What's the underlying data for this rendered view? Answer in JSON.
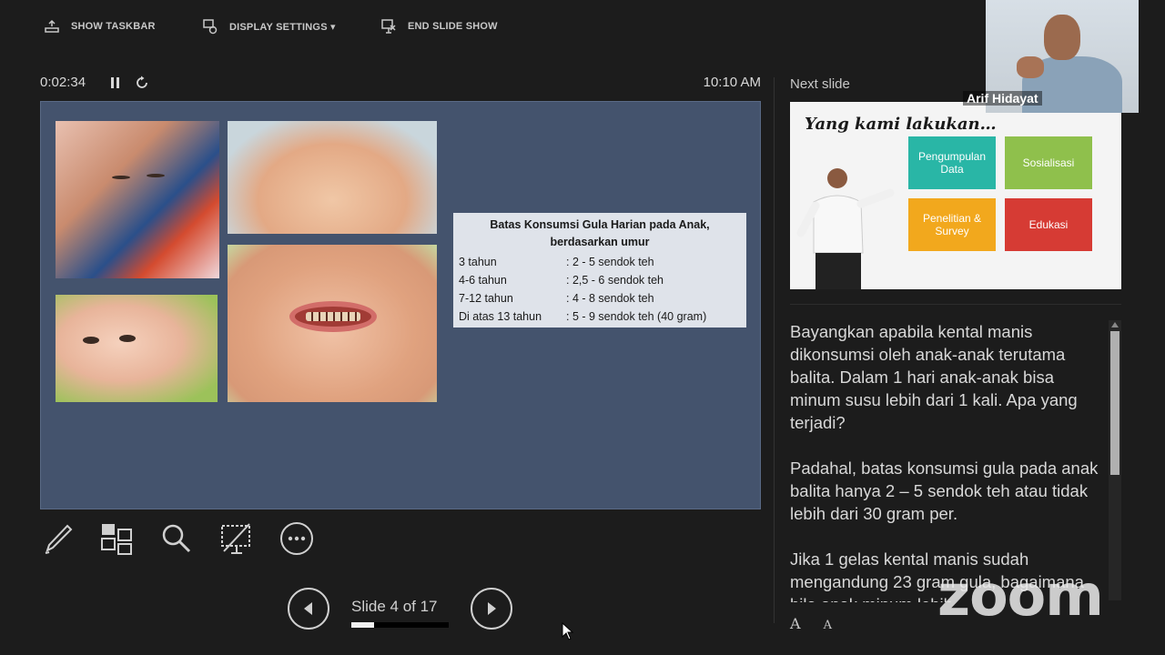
{
  "toolbar": {
    "show_taskbar": "SHOW TASKBAR",
    "display_settings": "DISPLAY SETTINGS ▾",
    "end_slide_show": "END SLIDE SHOW"
  },
  "presenter": {
    "timer": "0:02:34",
    "clock": "10:10 AM",
    "next_slide_label": "Next slide",
    "slide_counter": "Slide 4 of 17",
    "progress_fraction": 0.235
  },
  "current_slide": {
    "table_title": "Batas Konsumsi Gula Harian pada Anak, berdasarkan umur",
    "rows": [
      {
        "age": "3 tahun",
        "limit": ": 2 - 5 sendok teh"
      },
      {
        "age": "4-6 tahun",
        "limit": ": 2,5 - 6 sendok teh"
      },
      {
        "age": "7-12 tahun",
        "limit": ": 4 - 8 sendok teh"
      },
      {
        "age": "Di atas 13 tahun",
        "limit": ": 5 - 9 sendok teh (40 gram)"
      }
    ]
  },
  "next_slide": {
    "title": "Yang kami lakukan…",
    "tiles": [
      "Pengumpulan Data",
      "Sosialisasi",
      "Penelitian & Survey",
      "Edukasi"
    ],
    "colors": {
      "teal": "#29b6a6",
      "green": "#8fc04c",
      "orange": "#f2a81d",
      "red": "#d63b34"
    }
  },
  "notes": {
    "p1": "Bayangkan apabila kental manis dikonsumsi oleh anak-anak terutama balita. Dalam 1 hari anak-anak bisa minum susu lebih dari 1 kali. Apa yang terjadi?",
    "p2": "Padahal, batas konsumsi gula pada anak balita hanya 2 – 5 sendok teh atau tidak lebih dari 30 gram per.",
    "p3": "Jika 1 gelas kental manis sudah mengandung 23 gram gula, bagaimana bila anak minum lebih"
  },
  "font_controls": {
    "increase": "A",
    "decrease": "A"
  },
  "video": {
    "participant_name": "Arif Hidayat"
  },
  "watermark": "zoom"
}
